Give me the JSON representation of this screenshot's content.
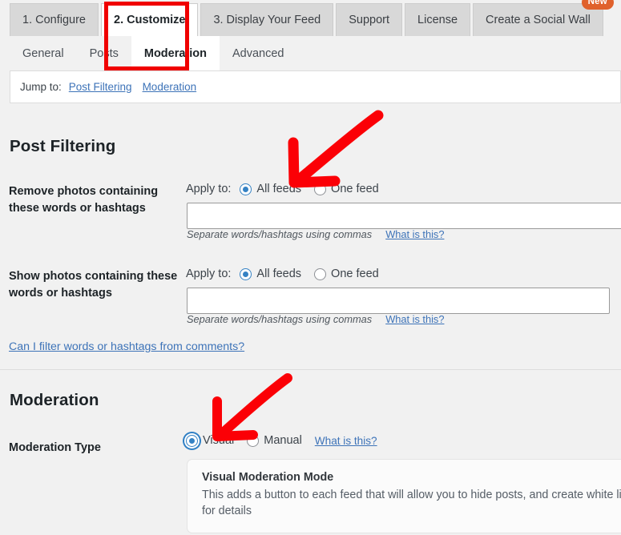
{
  "top_tabs": [
    {
      "label": "1. Configure",
      "active": false,
      "badge": null
    },
    {
      "label": "2. Customize",
      "active": true,
      "badge": null
    },
    {
      "label": "3. Display Your Feed",
      "active": false,
      "badge": null
    },
    {
      "label": "Support",
      "active": false,
      "badge": null
    },
    {
      "label": "License",
      "active": false,
      "badge": null
    },
    {
      "label": "Create a Social Wall",
      "active": false,
      "badge": "New"
    }
  ],
  "sub_tabs": [
    {
      "label": "General",
      "active": false
    },
    {
      "label": "Posts",
      "active": false
    },
    {
      "label": "Moderation",
      "active": true
    },
    {
      "label": "Advanced",
      "active": false
    }
  ],
  "jump_bar": {
    "label": "Jump to:",
    "links": [
      {
        "label": "Post Filtering"
      },
      {
        "label": "Moderation"
      }
    ]
  },
  "post_filtering": {
    "heading": "Post Filtering",
    "rows": [
      {
        "label": "Remove photos containing these words or hashtags",
        "apply_to_label": "Apply to:",
        "options": [
          {
            "label": "All feeds",
            "checked": true
          },
          {
            "label": "One feed",
            "checked": false
          }
        ],
        "input_value": "",
        "input_placeholder": "",
        "hint": "Separate words/hashtags using commas",
        "help_link": "What is this?"
      },
      {
        "label": "Show photos containing these words or hashtags",
        "apply_to_label": "Apply to:",
        "options": [
          {
            "label": "All feeds",
            "checked": true
          },
          {
            "label": "One feed",
            "checked": false
          }
        ],
        "input_value": "",
        "input_placeholder": "",
        "hint": "Separate words/hashtags using commas",
        "help_link": "What is this?"
      }
    ],
    "comments_link": "Can I filter words or hashtags from comments?"
  },
  "moderation": {
    "heading": "Moderation",
    "type_label": "Moderation Type",
    "options": [
      {
        "label": "Visual",
        "checked": true,
        "focused": true
      },
      {
        "label": "Manual",
        "checked": false,
        "focused": false
      }
    ],
    "help_link": "What is this?",
    "info_box": {
      "title": "Visual Moderation Mode",
      "body_line1": "This adds a button to each feed that will allow you to hide posts, and create white lists fro",
      "body_line2": "for details"
    }
  },
  "annotations": {
    "highlight_box_color": "#f00000",
    "arrow_color": "#fb0006",
    "arrows": [
      {
        "name": "arrow-to-all-feeds"
      },
      {
        "name": "arrow-to-visual-radio"
      }
    ]
  },
  "colors": {
    "page_bg": "#f1f1f1",
    "panel_bg": "#ffffff",
    "accent_blue": "#3582c4",
    "link_blue": "#3d73b8",
    "badge_orange": "#e0612c"
  }
}
